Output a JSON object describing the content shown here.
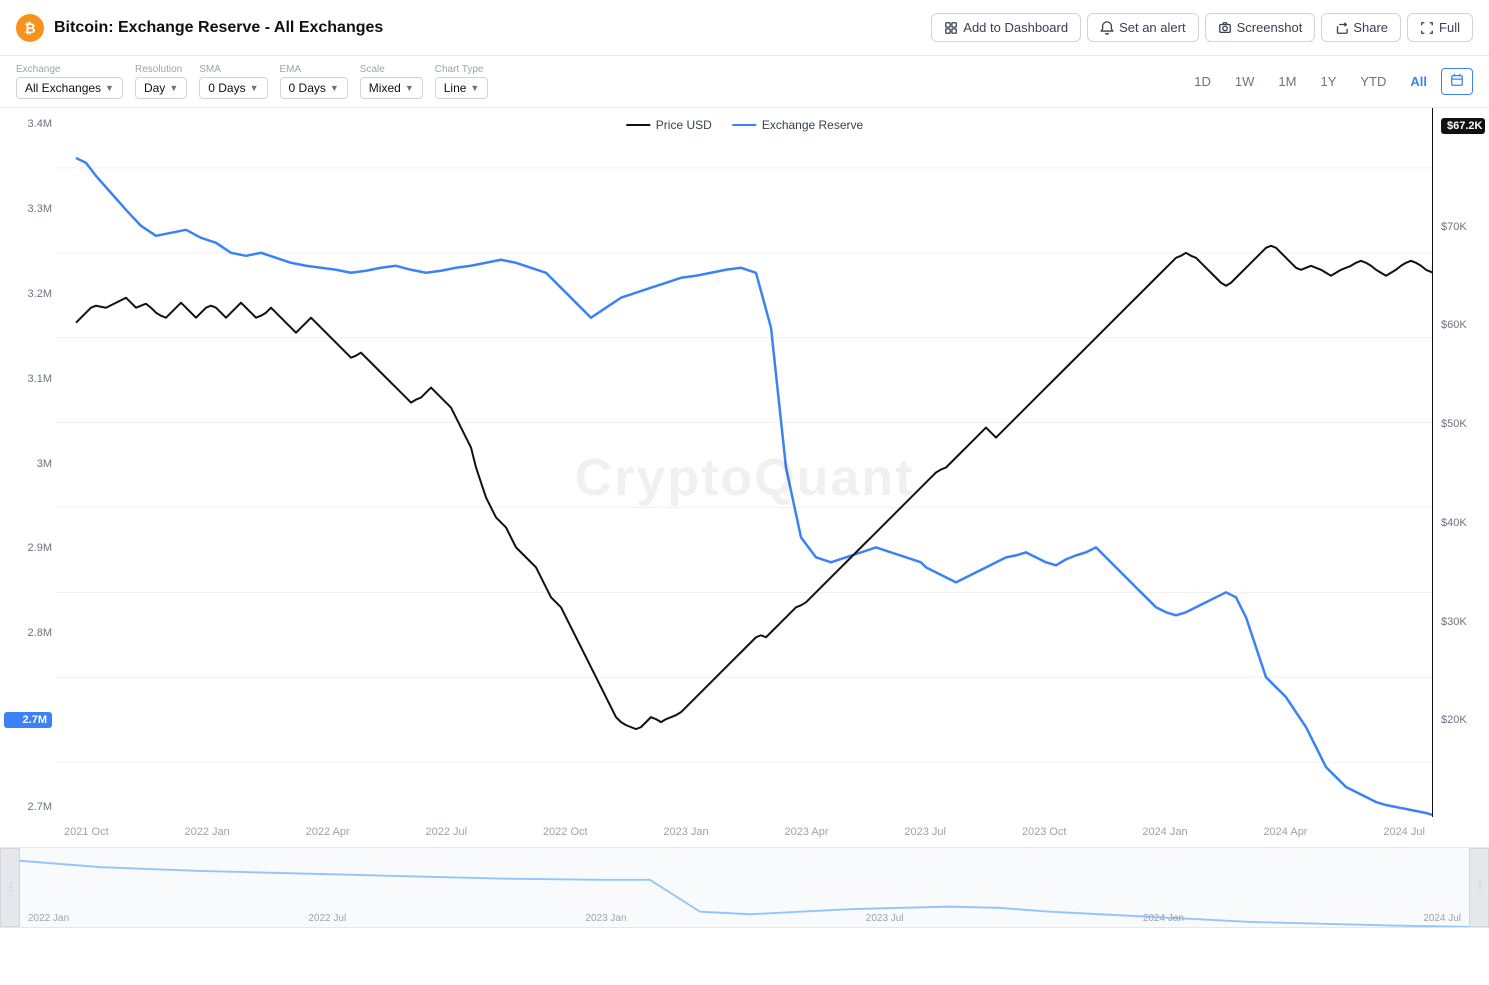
{
  "header": {
    "title": "Bitcoin: Exchange Reserve - All Exchanges",
    "btc_icon": "₿",
    "buttons": {
      "dashboard": "Add to Dashboard",
      "alert": "Set an alert",
      "screenshot": "Screenshot",
      "share": "Share",
      "full": "Full"
    }
  },
  "toolbar": {
    "exchange_label": "Exchange",
    "exchange_value": "All Exchanges",
    "resolution_label": "Resolution",
    "resolution_value": "Day",
    "sma_label": "SMA",
    "sma_value": "0 Days",
    "ema_label": "EMA",
    "ema_value": "0 Days",
    "scale_label": "Scale",
    "scale_value": "Mixed",
    "chart_type_label": "Chart Type",
    "chart_type_value": "Line"
  },
  "time_buttons": [
    "1D",
    "1W",
    "1M",
    "1Y",
    "YTD",
    "All"
  ],
  "active_time": "All",
  "legend": {
    "price_usd": "Price USD",
    "exchange_reserve": "Exchange Reserve"
  },
  "y_axis_left": {
    "labels": [
      "3.4M",
      "3.3M",
      "3.2M",
      "3.1M",
      "3M",
      "2.9M",
      "2.8M",
      "2.7M"
    ],
    "highlight": "2.7M"
  },
  "y_axis_right": {
    "labels": [
      "$70K",
      "$60K",
      "$50K",
      "$40K",
      "$30K",
      "$20K"
    ],
    "current": "$67.2K"
  },
  "x_axis_labels": [
    "2021 Oct",
    "2022 Jan",
    "2022 Apr",
    "2022 Jul",
    "2022 Oct",
    "2023 Jan",
    "2023 Apr",
    "2023 Jul",
    "2023 Oct",
    "2024 Jan",
    "2024 Apr",
    "2024 Jul"
  ],
  "minimap_x_labels": [
    "2022 Jan",
    "2022 Jul",
    "2023 Jan",
    "2023 Jul",
    "2024 Jan",
    "2024 Jul"
  ],
  "watermark": "CryptoQuant",
  "colors": {
    "blue": "#3b82f6",
    "black": "#111111",
    "highlight_blue": "#3b82f6",
    "price_badge": "#111111"
  }
}
